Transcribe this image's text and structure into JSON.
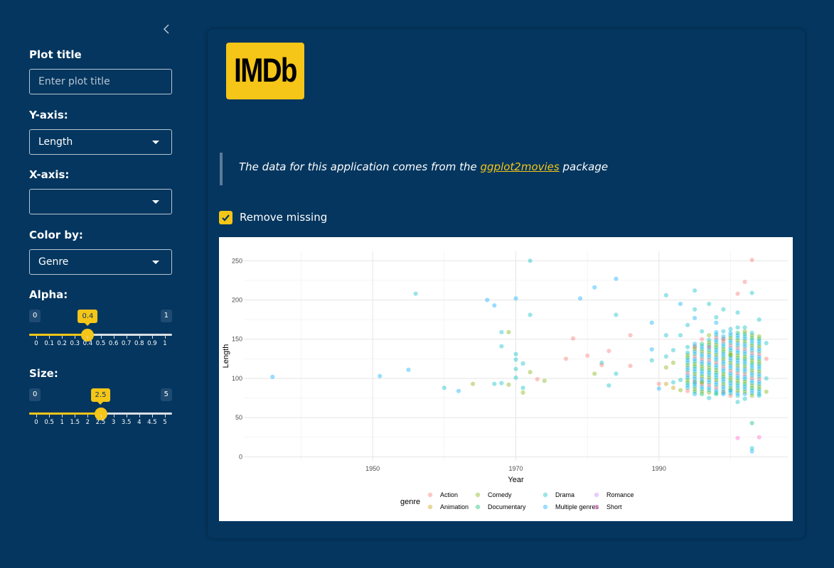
{
  "sidebar": {
    "plot_title_label": "Plot title",
    "plot_title_placeholder": "Enter plot title",
    "plot_title_value": "",
    "yaxis_label": "Y-axis:",
    "yaxis_value": "Length",
    "xaxis_label": "X-axis:",
    "xaxis_value": "",
    "color_label": "Color by:",
    "color_value": "Genre",
    "alpha": {
      "label": "Alpha:",
      "min": "0",
      "max": "1",
      "value": 0.4,
      "value_label": "0.4",
      "ticks": [
        "0",
        "0.1",
        "0.2",
        "0.3",
        "0.4",
        "0.5",
        "0.6",
        "0.7",
        "0.8",
        "0.9",
        "1"
      ]
    },
    "size": {
      "label": "Size:",
      "min": "0",
      "max": "5",
      "value": 2.5,
      "value_label": "2.5",
      "ticks": [
        "0",
        "0.5",
        "1",
        "1.5",
        "2",
        "2.5",
        "3",
        "3.5",
        "4",
        "4.5",
        "5"
      ]
    }
  },
  "main": {
    "logo_text": "IMDb",
    "quote_prefix": "The data for this application comes from the ",
    "quote_link": "ggplot2movies",
    "quote_suffix": " package",
    "remove_missing_label": "Remove missing",
    "remove_missing_checked": true
  },
  "colors": {
    "background": "#04365f",
    "accent": "#f5c518",
    "genre": {
      "Action": "#f8766d",
      "Animation": "#c49a00",
      "Comedy": "#7cae00",
      "Documentary": "#00be67",
      "Drama": "#00bfc4",
      "Multiple genres": "#00a9ff",
      "Romance": "#c77cff",
      "Short": "#ff61cc"
    }
  },
  "chart_data": {
    "type": "scatter",
    "title": "",
    "xlabel": "Year",
    "ylabel": "Length",
    "xlim": [
      1932,
      2008
    ],
    "ylim": [
      -5,
      262
    ],
    "x_ticks": [
      1950,
      1970,
      1990
    ],
    "y_ticks": [
      0,
      50,
      100,
      150,
      200,
      250
    ],
    "grid": true,
    "legend_title": "genre",
    "legend_position": "bottom",
    "legend": [
      "Action",
      "Animation",
      "Comedy",
      "Documentary",
      "Drama",
      "Multiple genres",
      "Romance",
      "Short"
    ],
    "points": [
      {
        "x": 1936,
        "y": 102,
        "g": "Multiple genres"
      },
      {
        "x": 1951,
        "y": 103,
        "g": "Multiple genres"
      },
      {
        "x": 1955,
        "y": 111,
        "g": "Multiple genres"
      },
      {
        "x": 1956,
        "y": 208,
        "g": "Drama"
      },
      {
        "x": 1960,
        "y": 88,
        "g": "Drama"
      },
      {
        "x": 1962,
        "y": 84,
        "g": "Multiple genres"
      },
      {
        "x": 1964,
        "y": 93,
        "g": "Comedy"
      },
      {
        "x": 1966,
        "y": 200,
        "g": "Multiple genres"
      },
      {
        "x": 1967,
        "y": 193,
        "g": "Multiple genres"
      },
      {
        "x": 1967,
        "y": 93,
        "g": "Drama"
      },
      {
        "x": 1968,
        "y": 159,
        "g": "Drama"
      },
      {
        "x": 1968,
        "y": 141,
        "g": "Drama"
      },
      {
        "x": 1968,
        "y": 94,
        "g": "Drama"
      },
      {
        "x": 1969,
        "y": 159,
        "g": "Comedy"
      },
      {
        "x": 1969,
        "y": 92,
        "g": "Comedy"
      },
      {
        "x": 1970,
        "y": 202,
        "g": "Multiple genres"
      },
      {
        "x": 1970,
        "y": 131,
        "g": "Drama"
      },
      {
        "x": 1970,
        "y": 124,
        "g": "Drama"
      },
      {
        "x": 1970,
        "y": 112,
        "g": "Drama"
      },
      {
        "x": 1970,
        "y": 101,
        "g": "Drama"
      },
      {
        "x": 1971,
        "y": 119,
        "g": "Drama"
      },
      {
        "x": 1971,
        "y": 88,
        "g": "Drama"
      },
      {
        "x": 1971,
        "y": 82,
        "g": "Comedy"
      },
      {
        "x": 1972,
        "y": 250,
        "g": "Drama"
      },
      {
        "x": 1972,
        "y": 181,
        "g": "Drama"
      },
      {
        "x": 1972,
        "y": 108,
        "g": "Comedy"
      },
      {
        "x": 1973,
        "y": 99,
        "g": "Action"
      },
      {
        "x": 1974,
        "y": 97,
        "g": "Comedy"
      },
      {
        "x": 1977,
        "y": 125,
        "g": "Action"
      },
      {
        "x": 1978,
        "y": 151,
        "g": "Action"
      },
      {
        "x": 1979,
        "y": 202,
        "g": "Multiple genres"
      },
      {
        "x": 1980,
        "y": 129,
        "g": "Action"
      },
      {
        "x": 1981,
        "y": 216,
        "g": "Multiple genres"
      },
      {
        "x": 1981,
        "y": 106,
        "g": "Comedy"
      },
      {
        "x": 1982,
        "y": 120,
        "g": "Drama"
      },
      {
        "x": 1982,
        "y": 117,
        "g": "Action"
      },
      {
        "x": 1983,
        "y": 135,
        "g": "Action"
      },
      {
        "x": 1983,
        "y": 91,
        "g": "Drama"
      },
      {
        "x": 1984,
        "y": 227,
        "g": "Multiple genres"
      },
      {
        "x": 1984,
        "y": 181,
        "g": "Drama"
      },
      {
        "x": 1984,
        "y": 106,
        "g": "Drama"
      },
      {
        "x": 1986,
        "y": 155,
        "g": "Action"
      },
      {
        "x": 1986,
        "y": 116,
        "g": "Action"
      },
      {
        "x": 1989,
        "y": 171,
        "g": "Multiple genres"
      },
      {
        "x": 1989,
        "y": 137,
        "g": "Multiple genres"
      },
      {
        "x": 1989,
        "y": 123,
        "g": "Drama"
      },
      {
        "x": 1990,
        "y": 93,
        "g": "Action"
      },
      {
        "x": 1990,
        "y": 87,
        "g": "Multiple genres"
      },
      {
        "x": 1991,
        "y": 206,
        "g": "Drama"
      },
      {
        "x": 1991,
        "y": 155,
        "g": "Drama"
      },
      {
        "x": 1991,
        "y": 128,
        "g": "Drama"
      },
      {
        "x": 1991,
        "y": 114,
        "g": "Comedy"
      },
      {
        "x": 1991,
        "y": 93,
        "g": "Animation"
      },
      {
        "x": 1992,
        "y": 136,
        "g": "Drama"
      },
      {
        "x": 1992,
        "y": 120,
        "g": "Comedy"
      },
      {
        "x": 1992,
        "y": 95,
        "g": "Drama"
      },
      {
        "x": 1992,
        "y": 88,
        "g": "Animation"
      },
      {
        "x": 1993,
        "y": 195,
        "g": "Multiple genres"
      },
      {
        "x": 1993,
        "y": 155,
        "g": "Drama"
      },
      {
        "x": 1993,
        "y": 98,
        "g": "Drama"
      },
      {
        "x": 1993,
        "y": 85,
        "g": "Comedy"
      },
      {
        "x": 1994,
        "y": 168,
        "g": "Drama"
      },
      {
        "x": 1994,
        "y": 140,
        "g": "Drama"
      },
      {
        "x": 1994,
        "y": 84,
        "g": "Action"
      },
      {
        "x": 1995,
        "y": 212,
        "g": "Drama"
      },
      {
        "x": 1995,
        "y": 188,
        "g": "Drama"
      },
      {
        "x": 1995,
        "y": 177,
        "g": "Multiple genres"
      },
      {
        "x": 1995,
        "y": 140,
        "g": "Action"
      },
      {
        "x": 1995,
        "y": 95,
        "g": "Drama"
      },
      {
        "x": 1996,
        "y": 160,
        "g": "Drama"
      },
      {
        "x": 1996,
        "y": 150,
        "g": "Action"
      },
      {
        "x": 1996,
        "y": 95,
        "g": "Comedy"
      },
      {
        "x": 1997,
        "y": 195,
        "g": "Drama"
      },
      {
        "x": 1997,
        "y": 155,
        "g": "Comedy"
      },
      {
        "x": 1997,
        "y": 140,
        "g": "Action"
      },
      {
        "x": 1997,
        "y": 75,
        "g": "Drama"
      },
      {
        "x": 1998,
        "y": 178,
        "g": "Drama"
      },
      {
        "x": 1998,
        "y": 171,
        "g": "Multiple genres"
      },
      {
        "x": 1998,
        "y": 80,
        "g": "Documentary"
      },
      {
        "x": 1999,
        "y": 188,
        "g": "Drama"
      },
      {
        "x": 1999,
        "y": 160,
        "g": "Drama"
      },
      {
        "x": 1999,
        "y": 150,
        "g": "Action"
      },
      {
        "x": 1999,
        "y": 82,
        "g": "Drama"
      },
      {
        "x": 2000,
        "y": 163,
        "g": "Drama"
      },
      {
        "x": 2000,
        "y": 130,
        "g": "Comedy"
      },
      {
        "x": 2000,
        "y": 85,
        "g": "Drama"
      },
      {
        "x": 2001,
        "y": 208,
        "g": "Action"
      },
      {
        "x": 2001,
        "y": 184,
        "g": "Drama"
      },
      {
        "x": 2001,
        "y": 165,
        "g": "Drama"
      },
      {
        "x": 2001,
        "y": 70,
        "g": "Drama"
      },
      {
        "x": 2001,
        "y": 24,
        "g": "Short"
      },
      {
        "x": 2002,
        "y": 223,
        "g": "Action"
      },
      {
        "x": 2002,
        "y": 165,
        "g": "Drama"
      },
      {
        "x": 2002,
        "y": 74,
        "g": "Drama"
      },
      {
        "x": 2003,
        "y": 251,
        "g": "Action"
      },
      {
        "x": 2003,
        "y": 209,
        "g": "Drama"
      },
      {
        "x": 2003,
        "y": 43,
        "g": "Documentary"
      },
      {
        "x": 2003,
        "y": 11,
        "g": "Drama"
      },
      {
        "x": 2003,
        "y": 7,
        "g": "Multiple genres"
      },
      {
        "x": 2004,
        "y": 175,
        "g": "Drama"
      },
      {
        "x": 2004,
        "y": 78,
        "g": "Drama"
      },
      {
        "x": 2004,
        "y": 25,
        "g": "Short"
      },
      {
        "x": 2005,
        "y": 145,
        "g": "Drama"
      },
      {
        "x": 2005,
        "y": 125,
        "g": "Action"
      },
      {
        "x": 2005,
        "y": 100,
        "g": "Drama"
      },
      {
        "x": 2005,
        "y": 83,
        "g": "Comedy"
      }
    ],
    "clusters": [
      {
        "x": 1994,
        "ymin": 88,
        "ymax": 135
      },
      {
        "x": 1995,
        "ymin": 80,
        "ymax": 145
      },
      {
        "x": 1996,
        "ymin": 80,
        "ymax": 145
      },
      {
        "x": 1997,
        "ymin": 82,
        "ymax": 150
      },
      {
        "x": 1998,
        "ymin": 82,
        "ymax": 160
      },
      {
        "x": 1999,
        "ymin": 80,
        "ymax": 155
      },
      {
        "x": 2000,
        "ymin": 78,
        "ymax": 160
      },
      {
        "x": 2001,
        "ymin": 78,
        "ymax": 160
      },
      {
        "x": 2002,
        "ymin": 80,
        "ymax": 160
      },
      {
        "x": 2003,
        "ymin": 78,
        "ymax": 158
      },
      {
        "x": 2004,
        "ymin": 80,
        "ymax": 155
      }
    ]
  }
}
